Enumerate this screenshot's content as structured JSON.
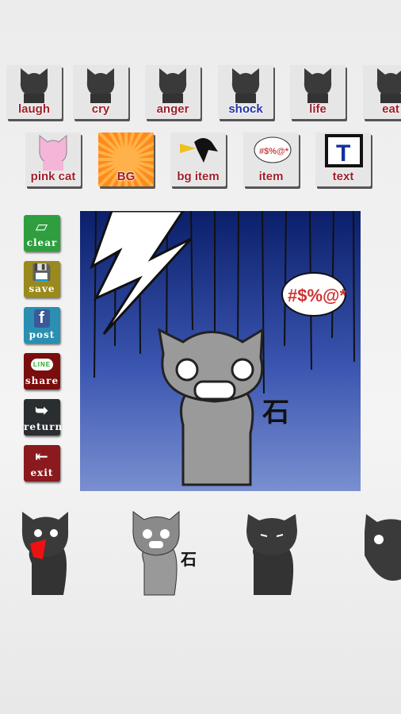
{
  "categories_row1": [
    {
      "label": "laugh",
      "color": "#a01f2a"
    },
    {
      "label": "cry",
      "color": "#a01f2a"
    },
    {
      "label": "anger",
      "color": "#a01f2a"
    },
    {
      "label": "shock",
      "color": "#2233aa"
    },
    {
      "label": "life",
      "color": "#a01f2a"
    },
    {
      "label": "eat",
      "color": "#a01f2a"
    }
  ],
  "categories_row2": [
    {
      "label": "pink cat"
    },
    {
      "label": "BG"
    },
    {
      "label": "bg item"
    },
    {
      "label": "item"
    },
    {
      "label": "text"
    }
  ],
  "text_tile_glyph": "T",
  "side_buttons": [
    {
      "label": "clear",
      "color": "#2e9e3e",
      "icon": "eraser-icon"
    },
    {
      "label": "save",
      "color": "#9a8a1e",
      "icon": "floppy-icon"
    },
    {
      "label": "post",
      "color": "#2a8fb0",
      "icon": "facebook-icon"
    },
    {
      "label": "share",
      "color": "#7a0d0d",
      "icon": "line-icon"
    },
    {
      "label": "return",
      "color": "#2a2e30",
      "icon": "return-icon"
    },
    {
      "label": "exit",
      "color": "#8a1a1e",
      "icon": "exit-icon"
    }
  ],
  "facebook_glyph": "f",
  "line_glyph": "LINE",
  "canvas": {
    "speech_text": "#$%@*",
    "stone_text": "石"
  },
  "bottom_stone_text": "石"
}
